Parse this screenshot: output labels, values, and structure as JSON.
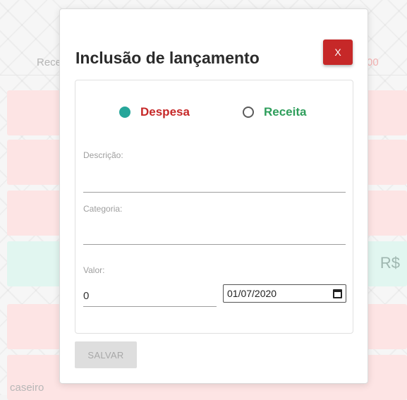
{
  "background": {
    "header_left": "Rece",
    "header_right": "00",
    "row_amount": "R$",
    "bottom_text": "caseiro"
  },
  "modal": {
    "title": "Inclusão de lançamento",
    "close_label": "X",
    "type_options": [
      {
        "label": "Despesa",
        "selected": true
      },
      {
        "label": "Receita",
        "selected": false
      }
    ],
    "descricao_label": "Descrição:",
    "descricao_value": "",
    "categoria_label": "Categoria:",
    "categoria_value": "",
    "valor_label": "Valor:",
    "valor_value": "0",
    "date_value": "01/07/2020",
    "save_label": "SALVAR"
  },
  "colors": {
    "close_button": "#c62828",
    "despesa": "#c62828",
    "receita": "#2e9e5b",
    "radio_selected": "#26a69a"
  }
}
